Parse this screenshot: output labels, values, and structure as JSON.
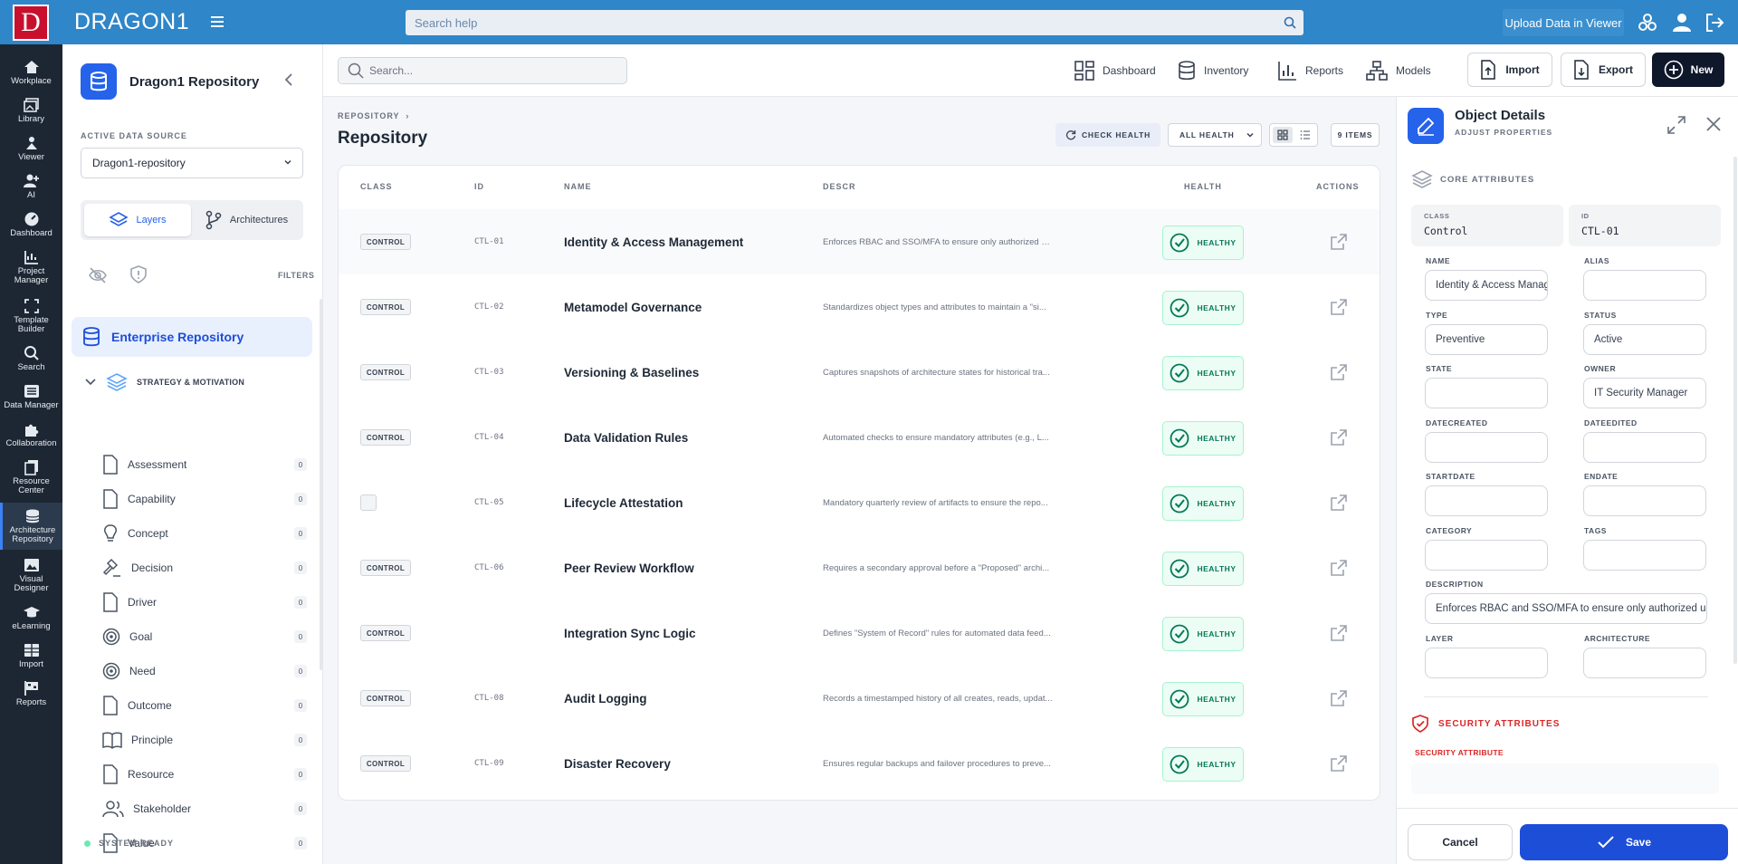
{
  "topbar": {
    "logo_letter": "D",
    "brand": "DRAGON1",
    "help_placeholder": "Search help",
    "upload_label": "Upload Data in Viewer",
    "icons": [
      "hamburger-icon",
      "search-icon",
      "network-icon",
      "user-icon",
      "logout-icon"
    ]
  },
  "rail": [
    {
      "label": "Workplace",
      "icon": "home-icon"
    },
    {
      "label": "Library",
      "icon": "image-stack-icon"
    },
    {
      "label": "Viewer",
      "icon": "viewer-icon"
    },
    {
      "label": "AI",
      "icon": "user-plus-icon"
    },
    {
      "label": "Dashboard",
      "icon": "gauge-icon"
    },
    {
      "label": "Project Manager",
      "icon": "chart-icon"
    },
    {
      "label": "Template Builder",
      "icon": "expand-icon"
    },
    {
      "label": "Search",
      "icon": "search-icon"
    },
    {
      "label": "Data Manager",
      "icon": "list-icon"
    },
    {
      "label": "Collaboration",
      "icon": "puzzle-icon"
    },
    {
      "label": "Resource Center",
      "icon": "copy-icon"
    },
    {
      "label": "Architecture Repository",
      "icon": "database-icon"
    },
    {
      "label": "Visual Designer",
      "icon": "image-icon"
    },
    {
      "label": "eLearning",
      "icon": "graduation-icon"
    },
    {
      "label": "Import",
      "icon": "table-icon"
    },
    {
      "label": "Reports",
      "icon": "flag-icon"
    }
  ],
  "sidebar": {
    "title": "Dragon1 Repository",
    "active_source_label": "ACTIVE DATA SOURCE",
    "active_source_value": "Dragon1-repository",
    "seg_layers": "Layers",
    "seg_architectures": "Architectures",
    "filters_label": "FILTERS",
    "enterprise_repo": "Enterprise Repository",
    "group_label": "STRATEGY & MOTIVATION",
    "items": [
      {
        "label": "Assessment",
        "count": "0",
        "icon": "document-icon"
      },
      {
        "label": "Capability",
        "count": "0",
        "icon": "document-icon"
      },
      {
        "label": "Concept",
        "count": "0",
        "icon": "lightbulb-icon"
      },
      {
        "label": "Decision",
        "count": "0",
        "icon": "gavel-icon"
      },
      {
        "label": "Driver",
        "count": "0",
        "icon": "document-icon"
      },
      {
        "label": "Goal",
        "count": "0",
        "icon": "target-icon"
      },
      {
        "label": "Need",
        "count": "0",
        "icon": "target-icon"
      },
      {
        "label": "Outcome",
        "count": "0",
        "icon": "document-icon"
      },
      {
        "label": "Principle",
        "count": "0",
        "icon": "book-icon"
      },
      {
        "label": "Resource",
        "count": "0",
        "icon": "document-icon"
      },
      {
        "label": "Stakeholder",
        "count": "0",
        "icon": "users-icon"
      },
      {
        "label": "Value",
        "count": "0",
        "icon": "document-icon"
      }
    ],
    "status": "SYSTEM READY"
  },
  "main": {
    "search_placeholder": "Search...",
    "nav": {
      "dashboard": "Dashboard",
      "inventory": "Inventory",
      "reports": "Reports",
      "models": "Models"
    },
    "import_label": "Import",
    "export_label": "Export",
    "new_label": "New",
    "breadcrumb": "REPOSITORY",
    "title": "Repository",
    "check_health": "CHECK HEALTH",
    "health_filter": "ALL HEALTH",
    "items_count": "9 ITEMS",
    "columns": {
      "class": "CLASS",
      "id": "ID",
      "name": "NAME",
      "descr": "DESCR",
      "health": "HEALTH",
      "actions": "ACTIONS"
    },
    "rows": [
      {
        "class": "CONTROL",
        "id": "CTL-01",
        "name": "Identity & Access Management",
        "descr": "Enforces RBAC and SSO/MFA to ensure only authorized us...",
        "health": "HEALTHY"
      },
      {
        "class": "CONTROL",
        "id": "CTL-02",
        "name": "Metamodel Governance",
        "descr": "Standardizes object types and attributes to maintain a \"si...",
        "health": "HEALTHY"
      },
      {
        "class": "CONTROL",
        "id": "CTL-03",
        "name": "Versioning & Baselines",
        "descr": "Captures snapshots of architecture states for historical tra...",
        "health": "HEALTHY"
      },
      {
        "class": "CONTROL",
        "id": "CTL-04",
        "name": "Data Validation Rules",
        "descr": "Automated checks to ensure mandatory attributes (e.g., L...",
        "health": "HEALTHY"
      },
      {
        "class": "",
        "id": "CTL-05",
        "name": "Lifecycle Attestation",
        "descr": "Mandatory quarterly review of artifacts to ensure the repo...",
        "health": "HEALTHY"
      },
      {
        "class": "CONTROL",
        "id": "CTL-06",
        "name": "Peer Review Workflow",
        "descr": "Requires a secondary approval before a \"Proposed\" archi...",
        "health": "HEALTHY"
      },
      {
        "class": "CONTROL",
        "id": "",
        "name": "Integration Sync Logic",
        "descr": "Defines \"System of Record\" rules for automated data feed...",
        "health": "HEALTHY"
      },
      {
        "class": "CONTROL",
        "id": "CTL-08",
        "name": "Audit Logging",
        "descr": "Records a timestamped history of all creates, reads, updat...",
        "health": "HEALTHY"
      },
      {
        "class": "CONTROL",
        "id": "CTL-09",
        "name": "Disaster Recovery",
        "descr": "Ensures regular backups and failover procedures to preve...",
        "health": "HEALTHY"
      }
    ]
  },
  "panel": {
    "title": "Object Details",
    "subtitle": "ADJUST PROPERTIES",
    "core_label": "CORE ATTRIBUTES",
    "class_label": "CLASS",
    "class_value": "Control",
    "id_label": "ID",
    "id_value": "CTL-01",
    "fields": {
      "name": {
        "label": "NAME",
        "value": "Identity & Access Management"
      },
      "alias": {
        "label": "ALIAS",
        "value": ""
      },
      "type": {
        "label": "TYPE",
        "value": "Preventive"
      },
      "status": {
        "label": "STATUS",
        "value": "Active"
      },
      "state": {
        "label": "STATE",
        "value": ""
      },
      "owner": {
        "label": "OWNER",
        "value": "IT Security Manager"
      },
      "datecreated": {
        "label": "DATECREATED",
        "value": ""
      },
      "dateedited": {
        "label": "DATEEDITED",
        "value": ""
      },
      "startdate": {
        "label": "STARTDATE",
        "value": ""
      },
      "enddate": {
        "label": "ENDATE",
        "value": ""
      },
      "category": {
        "label": "CATEGORY",
        "value": ""
      },
      "tags": {
        "label": "TAGS",
        "value": ""
      },
      "description": {
        "label": "DESCRIPTION",
        "value": "Enforces RBAC and SSO/MFA to ensure only authorized us"
      },
      "layer": {
        "label": "LAYER",
        "value": ""
      },
      "architecture": {
        "label": "ARCHITECTURE",
        "value": ""
      }
    },
    "security_label": "SECURITY ATTRIBUTES",
    "security_attr_label": "SECURITY ATTRIBUTE",
    "cancel_label": "Cancel",
    "save_label": "Save"
  },
  "colors": {
    "topbar": "#2f86c8",
    "rail": "#1d2733",
    "accent": "#2563eb",
    "healthy": "#047857",
    "danger": "#dc2626"
  }
}
